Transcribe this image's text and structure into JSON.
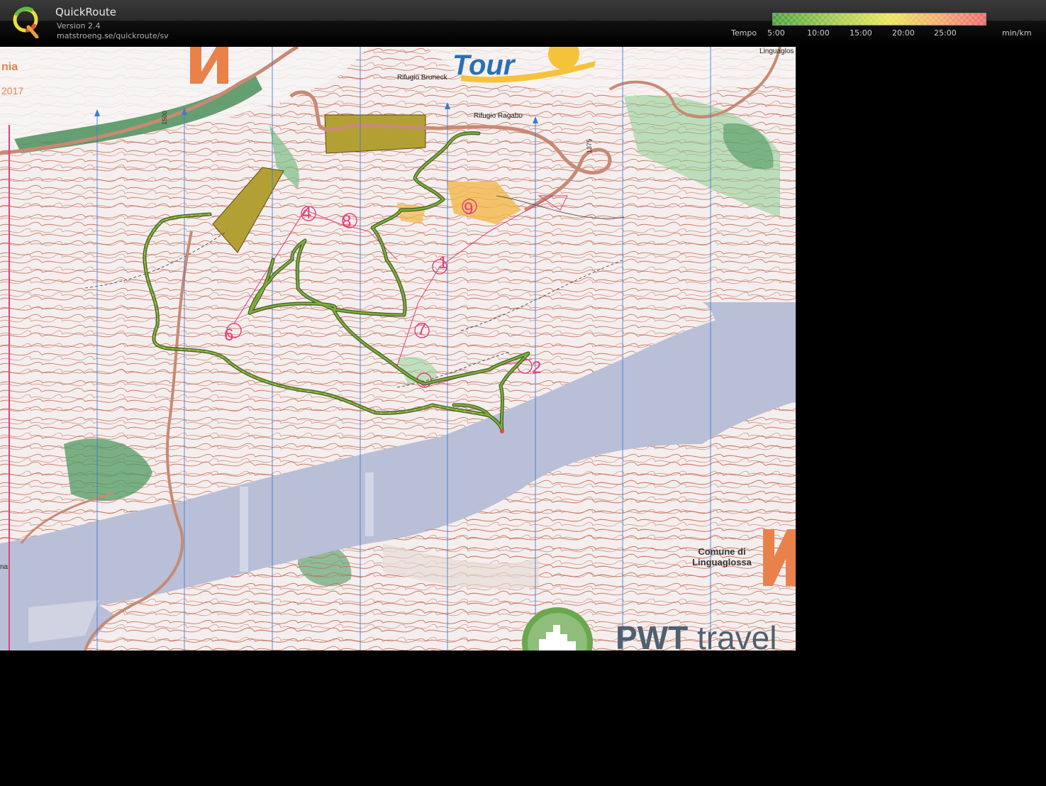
{
  "app": {
    "title": "QuickRoute",
    "version": "Version 2.4",
    "url": "matstroeng.se/quickroute/sv",
    "logo_icon": "quickroute-q-logo"
  },
  "legend": {
    "label": "Tempo",
    "ticks": [
      "5:00",
      "10:00",
      "15:00",
      "20:00",
      "25:00"
    ],
    "unit": "min/km",
    "colors": [
      "#4caf3a",
      "#8fc34a",
      "#e6e04a",
      "#f0a050",
      "#ee5a5a"
    ]
  },
  "map": {
    "labels": {
      "rifugio_bruneck": "Rifugio Bruneck",
      "rifugio_ragabo": "Rifugio Ragabo",
      "linguaglossa_top": "Linguaglos",
      "comune_line1": "Comune di",
      "comune_line2": "Linguaglossa",
      "title_fragment": "nia",
      "year_fragment": "2017",
      "contour_1500": "1500",
      "contour_1375": "1375",
      "left_fragment": "na"
    },
    "control_numbers": [
      "1",
      "2",
      "4",
      "6",
      "7",
      "8",
      "9"
    ],
    "brand_tour": "Tour",
    "brand_pwt_bold": "PWT",
    "brand_pwt_rest": " travel",
    "route_color": "#5f8a2c",
    "course_color": "#e0407a",
    "north_lines_color": "#3a7bd5",
    "lake_color": "#b9bfd6"
  }
}
